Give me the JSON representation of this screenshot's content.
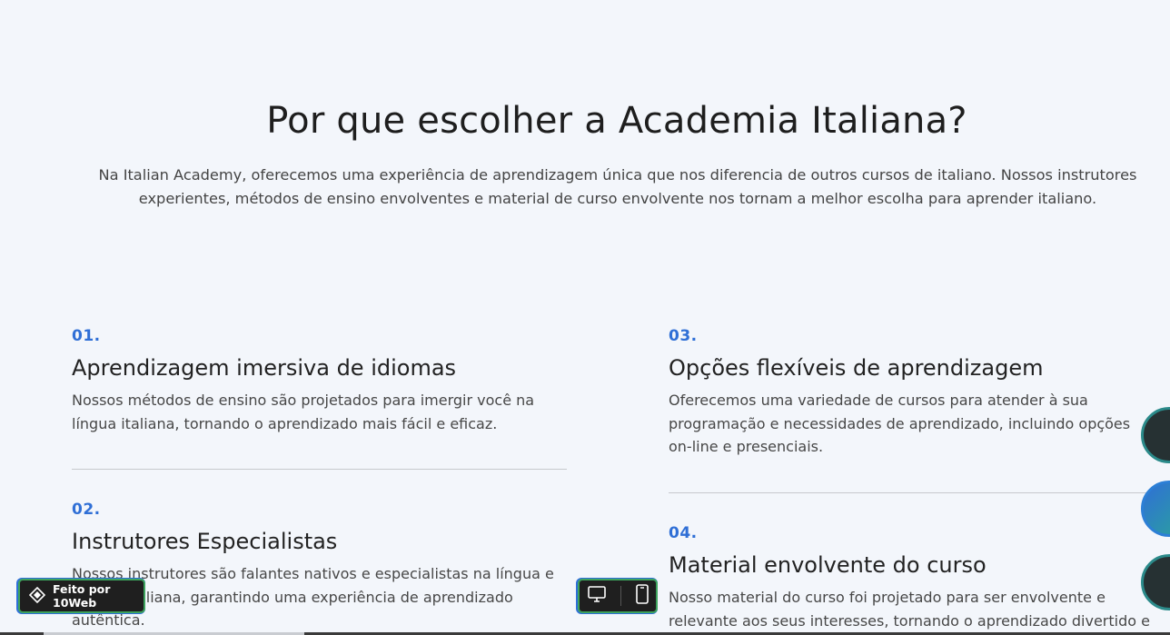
{
  "section": {
    "title": "Por que escolher a Academia Italiana?",
    "intro": "Na Italian Academy, oferecemos uma experiência de aprendizagem única que nos diferencia de outros cursos de italiano. Nossos instrutores experientes, métodos de ensino envolventes e material de curso envolvente nos tornam a melhor escolha para aprender italiano."
  },
  "features": [
    {
      "number": "01.",
      "title": "Aprendizagem imersiva de idiomas",
      "description": "Nossos métodos de ensino são projetados para imergir você na língua italiana, tornando o aprendizado mais fácil e eficaz."
    },
    {
      "number": "02.",
      "title": "Instrutores Especialistas",
      "description": "Nossos instrutores são falantes nativos e especialistas na língua e cultura italiana, garantindo uma experiência de aprendizado autêntica."
    },
    {
      "number": "03.",
      "title": "Opções flexíveis de aprendizagem",
      "description": "Oferecemos uma variedade de cursos para atender à sua programação e necessidades de aprendizado, incluindo opções on-line e presenciais."
    },
    {
      "number": "04.",
      "title": "Material envolvente do curso",
      "description": "Nosso material do curso foi projetado para ser envolvente e relevante aos seus interesses, tornando o aprendizado divertido e"
    }
  ],
  "badge": {
    "label": "Feito por 10Web",
    "icon": "10web-logo-icon"
  },
  "device_toggle": {
    "desktop_icon": "desktop-icon",
    "mobile_icon": "mobile-icon"
  },
  "colors": {
    "accent": "#2f6fd6",
    "badge_border": "#3da35d",
    "background": "#f3f6fb"
  }
}
